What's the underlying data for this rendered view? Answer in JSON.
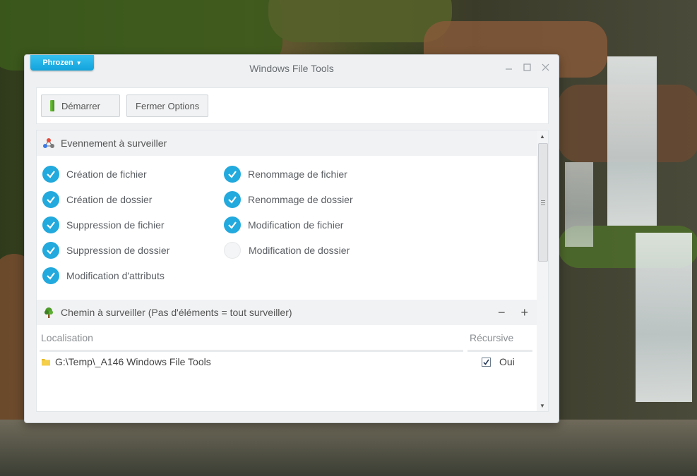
{
  "window": {
    "brand_label": "Phrozen",
    "brand_caret": "▼",
    "title": "Windows File Tools",
    "controls": {
      "minimize": "—",
      "maximize": "☐",
      "close": "✕"
    }
  },
  "toolbar": {
    "start_label": "Démarrer",
    "close_options_label": "Fermer Options"
  },
  "events_section": {
    "title": "Evennement à surveiller",
    "items": [
      {
        "label": "Création de fichier",
        "checked": true
      },
      {
        "label": "Renommage de fichier",
        "checked": true
      },
      {
        "label": "Création de dossier",
        "checked": true
      },
      {
        "label": "Renommage de dossier",
        "checked": true
      },
      {
        "label": "Suppression de fichier",
        "checked": true
      },
      {
        "label": "Modification de fichier",
        "checked": true
      },
      {
        "label": "Suppression de dossier",
        "checked": true
      },
      {
        "label": "Modification de dossier",
        "checked": false
      },
      {
        "label": "Modification d'attributs",
        "checked": true
      }
    ]
  },
  "paths_section": {
    "title": "Chemin à surveiller (Pas d'éléments = tout surveiller)",
    "remove_label": "−",
    "add_label": "+",
    "columns": [
      "Localisation",
      "Récursive"
    ],
    "rows": [
      {
        "path": "G:\\Temp\\_A146 Windows File Tools",
        "recursive_checked": true,
        "recursive_label": "Oui"
      }
    ]
  },
  "colors": {
    "accent": "#22a9dd",
    "brand": "#12a3dc",
    "start_icon": "#5aad2e"
  }
}
